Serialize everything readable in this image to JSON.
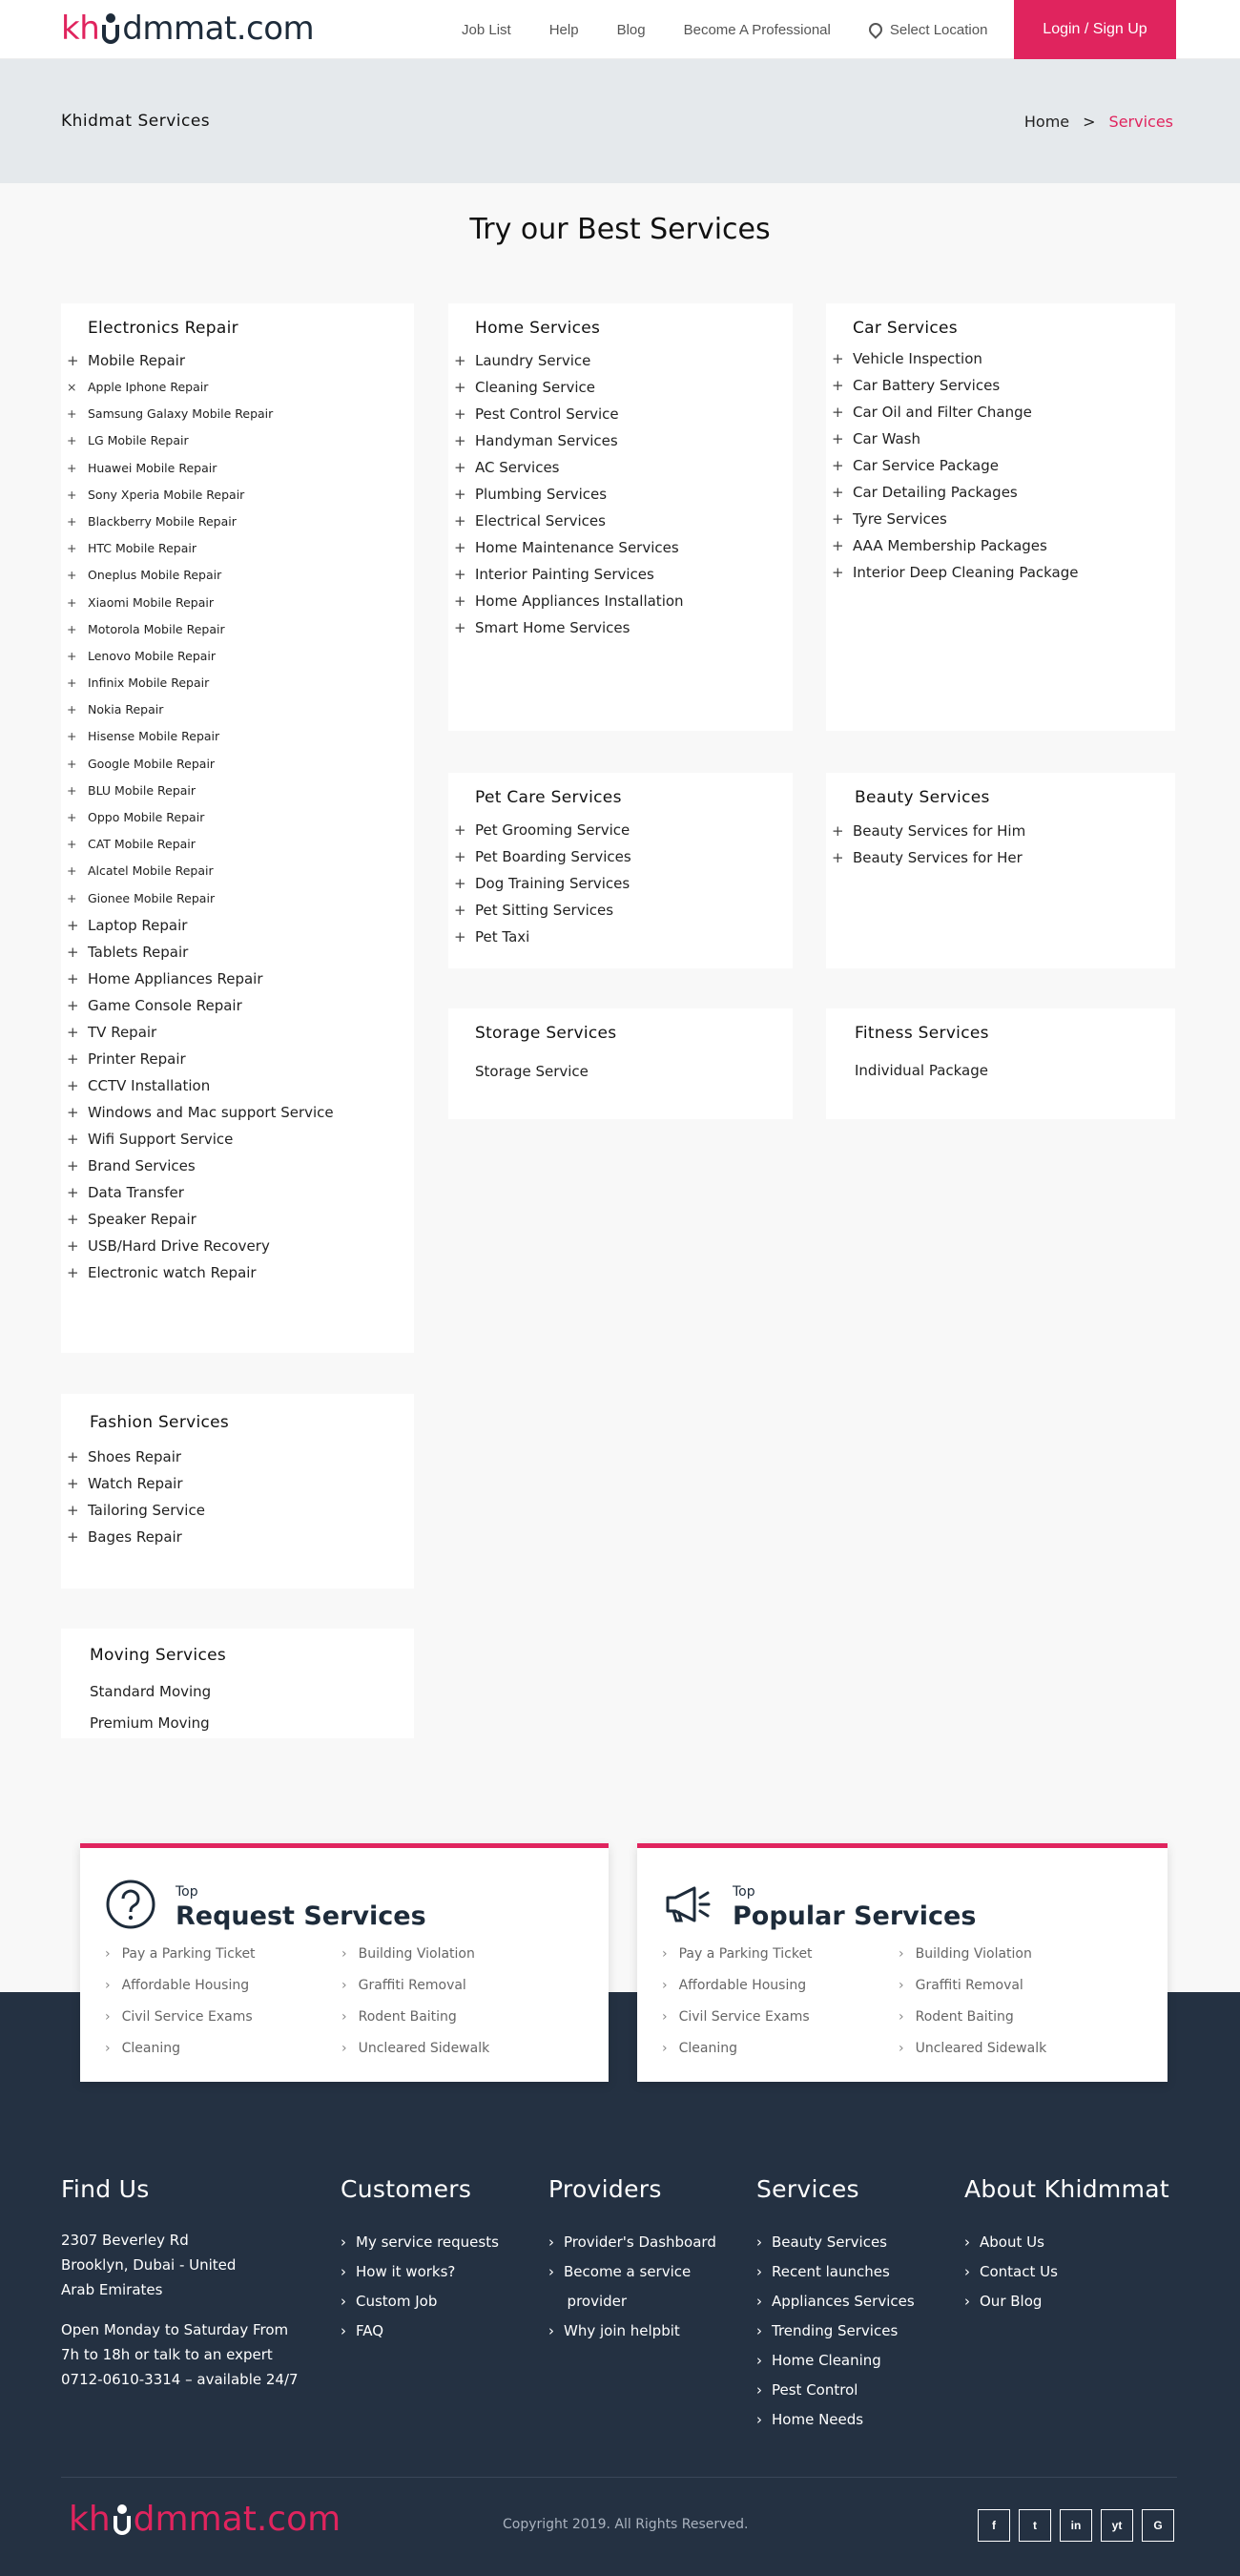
{
  "header": {
    "logo": {
      "brand": "kh",
      "brand2": "dmmat",
      "tld": ".com"
    },
    "nav": [
      "Job List",
      "Help",
      "Blog",
      "Become A Professional"
    ],
    "location": "Select Location",
    "login": "Login / Sign Up"
  },
  "band": {
    "title": "Khidmat Services",
    "crumb_home": "Home",
    "crumb_sep": ">",
    "crumb_active": "Services"
  },
  "section_title": "Try our Best Services",
  "cards": {
    "electronics": {
      "title": "Electronics Repair",
      "items": [
        "Mobile Repair",
        "Apple Iphone Repair",
        "Samsung Galaxy Mobile Repair",
        "LG Mobile Repair",
        "Huawei Mobile Repair",
        "Sony Xperia Mobile Repair",
        "Blackberry Mobile Repair",
        "HTC Mobile Repair",
        "Oneplus Mobile Repair",
        "Xiaomi Mobile Repair",
        "Motorola Mobile Repair",
        "Lenovo Mobile Repair",
        "Infinix Mobile Repair",
        "Nokia Repair",
        "Hisense Mobile Repair",
        "Google Mobile Repair",
        "BLU Mobile Repair",
        "Oppo Mobile Repair",
        "CAT Mobile Repair",
        "Alcatel Mobile Repair",
        "Gionee Mobile Repair",
        "Laptop Repair",
        "Tablets Repair",
        "Home Appliances Repair",
        "Game Console Repair",
        "TV Repair",
        "Printer Repair",
        "CCTV Installation",
        "Windows and Mac support Service",
        "Wifi Support Service",
        "Brand Services",
        "Data Transfer",
        "Speaker Repair",
        "USB/Hard Drive Recovery",
        "Electronic watch Repair"
      ]
    },
    "home": {
      "title": "Home Services",
      "items": [
        "Laundry Service",
        "Cleaning Service",
        "Pest Control Service",
        "Handyman Services",
        "AC Services",
        "Plumbing Services",
        "Electrical Services",
        "Home Maintenance Services",
        "Interior Painting Services",
        "Home Appliances Installation",
        "Smart Home Services"
      ]
    },
    "car": {
      "title": "Car Services",
      "items": [
        "Vehicle Inspection",
        "Car Battery Services",
        "Car Oil and Filter Change",
        "Car Wash",
        "Car Service Package",
        "Car Detailing Packages",
        "Tyre Services",
        "AAA Membership Packages",
        "Interior Deep Cleaning Package"
      ]
    },
    "pet": {
      "title": "Pet Care Services",
      "items": [
        "Pet Grooming Service",
        "Pet Boarding Services",
        "Dog Training Services",
        "Pet Sitting Services",
        "Pet Taxi"
      ]
    },
    "beauty": {
      "title": "Beauty Services",
      "items": [
        "Beauty Services for Him",
        "Beauty Services for Her"
      ]
    },
    "storage": {
      "title": "Storage Services",
      "items": [
        "Storage Service"
      ]
    },
    "fitness": {
      "title": "Fitness Services",
      "items": [
        "Individual Package"
      ]
    },
    "fashion": {
      "title": "Fashion Services",
      "items": [
        "Shoes Repair",
        "Watch Repair",
        "Tailoring Service",
        "Bages Repair"
      ]
    },
    "moving": {
      "title": "Moving Services",
      "items": [
        "Standard Moving",
        "Premium Moving"
      ]
    }
  },
  "promos": [
    {
      "eyebrow": "Top",
      "title": "Request Services",
      "icon": "question-circle-icon",
      "links": [
        "Pay a Parking Ticket",
        "Building Violation",
        "Affordable Housing",
        "Graffiti Removal",
        "Civil Service Exams",
        "Rodent Baiting",
        "Cleaning",
        "Uncleared Sidewalk"
      ]
    },
    {
      "eyebrow": "Top",
      "title": "Popular Services",
      "icon": "megaphone-icon",
      "links": [
        "Pay a Parking Ticket",
        "Building Violation",
        "Affordable Housing",
        "Graffiti Removal",
        "Civil Service Exams",
        "Rodent Baiting",
        "Cleaning",
        "Uncleared Sidewalk"
      ]
    }
  ],
  "footer": {
    "find_us": {
      "title": "Find Us",
      "address": [
        "2307 Beverley Rd",
        "Brooklyn, Dubai - United",
        "Arab Emirates"
      ],
      "hours": [
        "Open Monday to Saturday From",
        "7h to 18h or talk to an expert",
        "0712-0610-3314 – available 24/7"
      ]
    },
    "customers": {
      "title": "Customers",
      "links": [
        "My service requests",
        "How it works?",
        "Custom Job",
        "FAQ"
      ]
    },
    "providers": {
      "title": "Providers",
      "links": [
        "Provider's Dashboard",
        "Become a service",
        "provider",
        "Why join helpbit"
      ]
    },
    "services": {
      "title": "Services",
      "links": [
        "Beauty Services",
        "Recent launches",
        "Appliances Services",
        "Trending Services",
        "Home Cleaning",
        "Pest Control",
        "Home Needs"
      ]
    },
    "about": {
      "title": "About Khidmmat",
      "links": [
        "About Us",
        "Contact Us",
        "Our Blog"
      ]
    },
    "copyright": "Copyright 2019. All Rights Reserved.",
    "social": [
      "f",
      "t",
      "in",
      "yt",
      "G"
    ]
  },
  "colors": {
    "accent": "#e0245e",
    "dark": "#243142",
    "band": "#e5e9ec"
  }
}
